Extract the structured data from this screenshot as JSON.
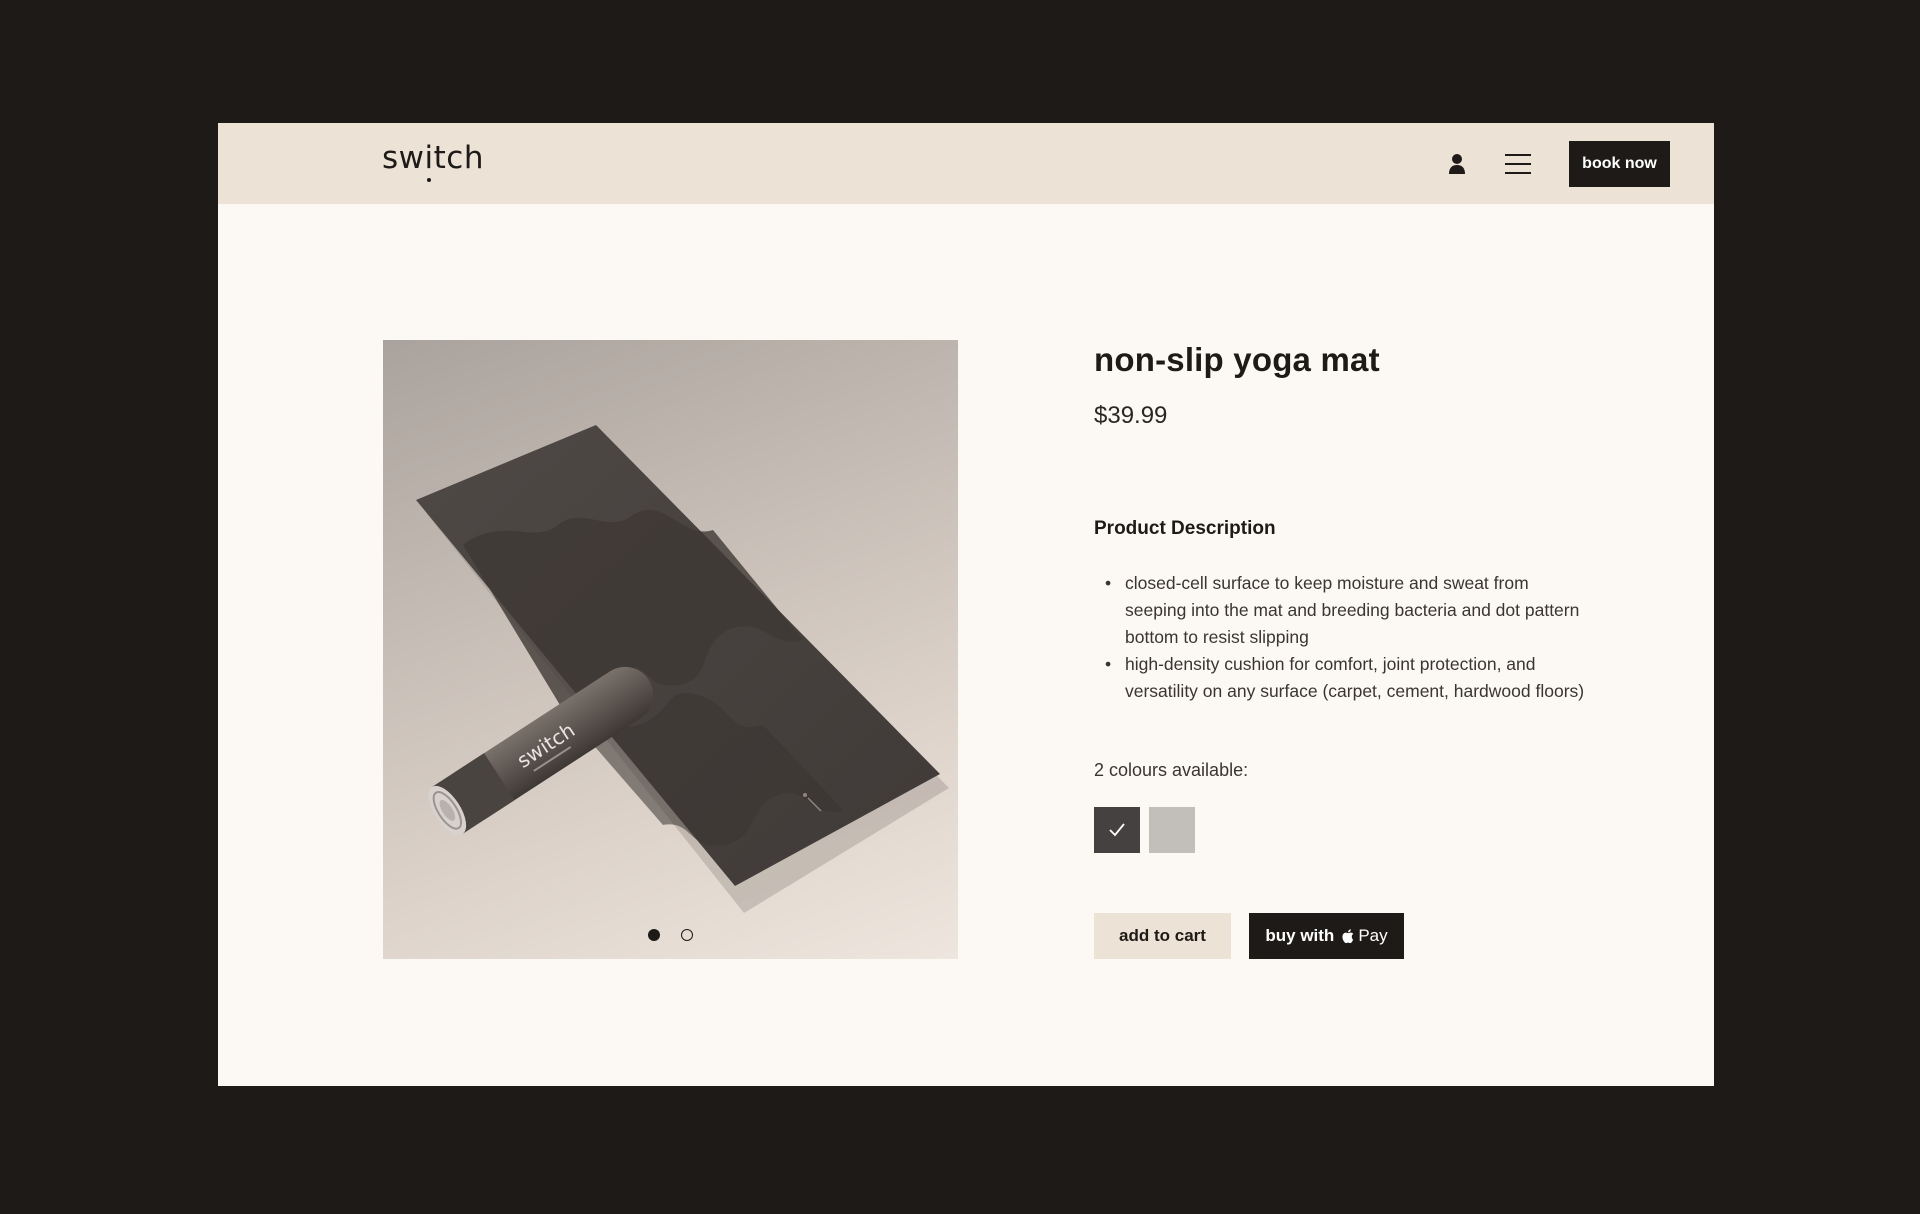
{
  "header": {
    "logo": {
      "pre": "sw",
      "i": "i",
      "post": "tch"
    },
    "book_label": "book now"
  },
  "product": {
    "title": "non-slip yoga mat",
    "price": "$39.99",
    "image_logo": "switch",
    "carousel": {
      "total_slides": 2,
      "active_slide": 1
    },
    "description_heading": "Product Description",
    "description_items": [
      "closed-cell surface to keep moisture and sweat from seeping into the mat and breeding bacteria and dot pattern bottom to resist slipping",
      "high-density cushion for comfort, joint protection, and versatility on any surface (carpet, cement, hardwood floors)"
    ],
    "colours_label": "2 colours available:",
    "colours": [
      {
        "hex": "#454140",
        "selected": true
      },
      {
        "hex": "#c2bfbb",
        "selected": false
      }
    ],
    "add_to_cart_label": "add to cart",
    "buy_label": "buy with",
    "pay_label": "Pay"
  },
  "colors": {
    "page_bg": "#1e1a17",
    "frame_bg": "#fcf9f4",
    "nav_bg": "#ede2d6",
    "dark": "#1e1a17"
  },
  "icons": {
    "user": "user-icon",
    "menu": "menu-icon",
    "apple": "apple-icon",
    "check": "check-icon"
  }
}
